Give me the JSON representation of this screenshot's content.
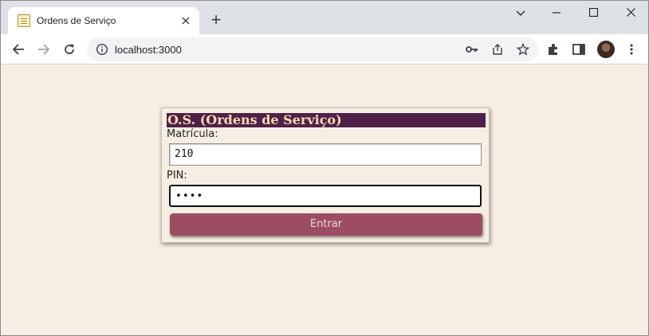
{
  "browser": {
    "tab_title": "Ordens de Serviço",
    "url": "localhost:3000",
    "new_tab_label": "+"
  },
  "login": {
    "title": "O.S. (Ordens de Serviço)",
    "matricula_label": "Matrícula:",
    "matricula_value": "210",
    "pin_label": "PIN:",
    "pin_value": "••••",
    "submit_label": "Entrar"
  },
  "colors": {
    "page_background": "#f7eee3",
    "title_bar": "#4f2148",
    "title_text": "#f6d9b0",
    "button": "#9c4d62"
  },
  "icons": [
    "favicon-icon",
    "close-icon",
    "chevron-down-icon",
    "minimize-icon",
    "maximize-icon",
    "close-window-icon",
    "back-icon",
    "forward-icon",
    "reload-icon",
    "info-icon",
    "key-icon",
    "share-icon",
    "star-icon",
    "extensions-icon",
    "side-panel-icon",
    "profile-avatar",
    "kebab-menu-icon"
  ]
}
